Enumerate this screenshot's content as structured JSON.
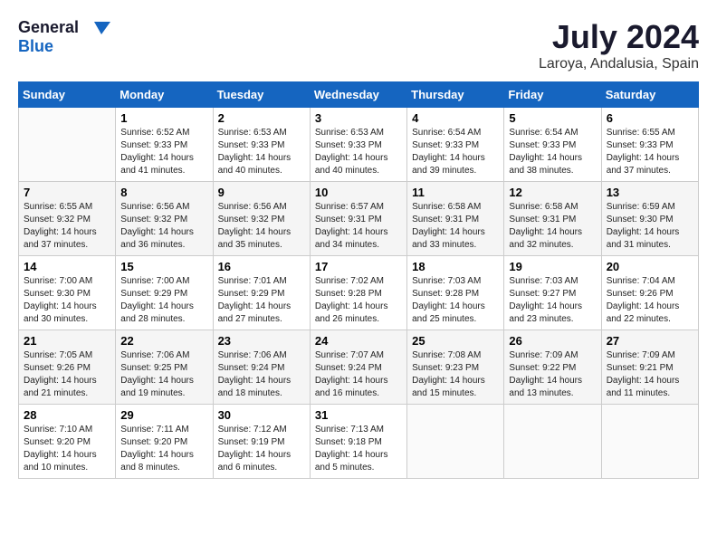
{
  "logo": {
    "line1": "General",
    "line2": "Blue"
  },
  "title": "July 2024",
  "location": "Laroya, Andalusia, Spain",
  "days_header": [
    "Sunday",
    "Monday",
    "Tuesday",
    "Wednesday",
    "Thursday",
    "Friday",
    "Saturday"
  ],
  "weeks": [
    [
      {
        "day": "",
        "sunrise": "",
        "sunset": "",
        "daylight": ""
      },
      {
        "day": "1",
        "sunrise": "Sunrise: 6:52 AM",
        "sunset": "Sunset: 9:33 PM",
        "daylight": "Daylight: 14 hours and 41 minutes."
      },
      {
        "day": "2",
        "sunrise": "Sunrise: 6:53 AM",
        "sunset": "Sunset: 9:33 PM",
        "daylight": "Daylight: 14 hours and 40 minutes."
      },
      {
        "day": "3",
        "sunrise": "Sunrise: 6:53 AM",
        "sunset": "Sunset: 9:33 PM",
        "daylight": "Daylight: 14 hours and 40 minutes."
      },
      {
        "day": "4",
        "sunrise": "Sunrise: 6:54 AM",
        "sunset": "Sunset: 9:33 PM",
        "daylight": "Daylight: 14 hours and 39 minutes."
      },
      {
        "day": "5",
        "sunrise": "Sunrise: 6:54 AM",
        "sunset": "Sunset: 9:33 PM",
        "daylight": "Daylight: 14 hours and 38 minutes."
      },
      {
        "day": "6",
        "sunrise": "Sunrise: 6:55 AM",
        "sunset": "Sunset: 9:33 PM",
        "daylight": "Daylight: 14 hours and 37 minutes."
      }
    ],
    [
      {
        "day": "7",
        "sunrise": "Sunrise: 6:55 AM",
        "sunset": "Sunset: 9:32 PM",
        "daylight": "Daylight: 14 hours and 37 minutes."
      },
      {
        "day": "8",
        "sunrise": "Sunrise: 6:56 AM",
        "sunset": "Sunset: 9:32 PM",
        "daylight": "Daylight: 14 hours and 36 minutes."
      },
      {
        "day": "9",
        "sunrise": "Sunrise: 6:56 AM",
        "sunset": "Sunset: 9:32 PM",
        "daylight": "Daylight: 14 hours and 35 minutes."
      },
      {
        "day": "10",
        "sunrise": "Sunrise: 6:57 AM",
        "sunset": "Sunset: 9:31 PM",
        "daylight": "Daylight: 14 hours and 34 minutes."
      },
      {
        "day": "11",
        "sunrise": "Sunrise: 6:58 AM",
        "sunset": "Sunset: 9:31 PM",
        "daylight": "Daylight: 14 hours and 33 minutes."
      },
      {
        "day": "12",
        "sunrise": "Sunrise: 6:58 AM",
        "sunset": "Sunset: 9:31 PM",
        "daylight": "Daylight: 14 hours and 32 minutes."
      },
      {
        "day": "13",
        "sunrise": "Sunrise: 6:59 AM",
        "sunset": "Sunset: 9:30 PM",
        "daylight": "Daylight: 14 hours and 31 minutes."
      }
    ],
    [
      {
        "day": "14",
        "sunrise": "Sunrise: 7:00 AM",
        "sunset": "Sunset: 9:30 PM",
        "daylight": "Daylight: 14 hours and 30 minutes."
      },
      {
        "day": "15",
        "sunrise": "Sunrise: 7:00 AM",
        "sunset": "Sunset: 9:29 PM",
        "daylight": "Daylight: 14 hours and 28 minutes."
      },
      {
        "day": "16",
        "sunrise": "Sunrise: 7:01 AM",
        "sunset": "Sunset: 9:29 PM",
        "daylight": "Daylight: 14 hours and 27 minutes."
      },
      {
        "day": "17",
        "sunrise": "Sunrise: 7:02 AM",
        "sunset": "Sunset: 9:28 PM",
        "daylight": "Daylight: 14 hours and 26 minutes."
      },
      {
        "day": "18",
        "sunrise": "Sunrise: 7:03 AM",
        "sunset": "Sunset: 9:28 PM",
        "daylight": "Daylight: 14 hours and 25 minutes."
      },
      {
        "day": "19",
        "sunrise": "Sunrise: 7:03 AM",
        "sunset": "Sunset: 9:27 PM",
        "daylight": "Daylight: 14 hours and 23 minutes."
      },
      {
        "day": "20",
        "sunrise": "Sunrise: 7:04 AM",
        "sunset": "Sunset: 9:26 PM",
        "daylight": "Daylight: 14 hours and 22 minutes."
      }
    ],
    [
      {
        "day": "21",
        "sunrise": "Sunrise: 7:05 AM",
        "sunset": "Sunset: 9:26 PM",
        "daylight": "Daylight: 14 hours and 21 minutes."
      },
      {
        "day": "22",
        "sunrise": "Sunrise: 7:06 AM",
        "sunset": "Sunset: 9:25 PM",
        "daylight": "Daylight: 14 hours and 19 minutes."
      },
      {
        "day": "23",
        "sunrise": "Sunrise: 7:06 AM",
        "sunset": "Sunset: 9:24 PM",
        "daylight": "Daylight: 14 hours and 18 minutes."
      },
      {
        "day": "24",
        "sunrise": "Sunrise: 7:07 AM",
        "sunset": "Sunset: 9:24 PM",
        "daylight": "Daylight: 14 hours and 16 minutes."
      },
      {
        "day": "25",
        "sunrise": "Sunrise: 7:08 AM",
        "sunset": "Sunset: 9:23 PM",
        "daylight": "Daylight: 14 hours and 15 minutes."
      },
      {
        "day": "26",
        "sunrise": "Sunrise: 7:09 AM",
        "sunset": "Sunset: 9:22 PM",
        "daylight": "Daylight: 14 hours and 13 minutes."
      },
      {
        "day": "27",
        "sunrise": "Sunrise: 7:09 AM",
        "sunset": "Sunset: 9:21 PM",
        "daylight": "Daylight: 14 hours and 11 minutes."
      }
    ],
    [
      {
        "day": "28",
        "sunrise": "Sunrise: 7:10 AM",
        "sunset": "Sunset: 9:20 PM",
        "daylight": "Daylight: 14 hours and 10 minutes."
      },
      {
        "day": "29",
        "sunrise": "Sunrise: 7:11 AM",
        "sunset": "Sunset: 9:20 PM",
        "daylight": "Daylight: 14 hours and 8 minutes."
      },
      {
        "day": "30",
        "sunrise": "Sunrise: 7:12 AM",
        "sunset": "Sunset: 9:19 PM",
        "daylight": "Daylight: 14 hours and 6 minutes."
      },
      {
        "day": "31",
        "sunrise": "Sunrise: 7:13 AM",
        "sunset": "Sunset: 9:18 PM",
        "daylight": "Daylight: 14 hours and 5 minutes."
      },
      {
        "day": "",
        "sunrise": "",
        "sunset": "",
        "daylight": ""
      },
      {
        "day": "",
        "sunrise": "",
        "sunset": "",
        "daylight": ""
      },
      {
        "day": "",
        "sunrise": "",
        "sunset": "",
        "daylight": ""
      }
    ]
  ]
}
